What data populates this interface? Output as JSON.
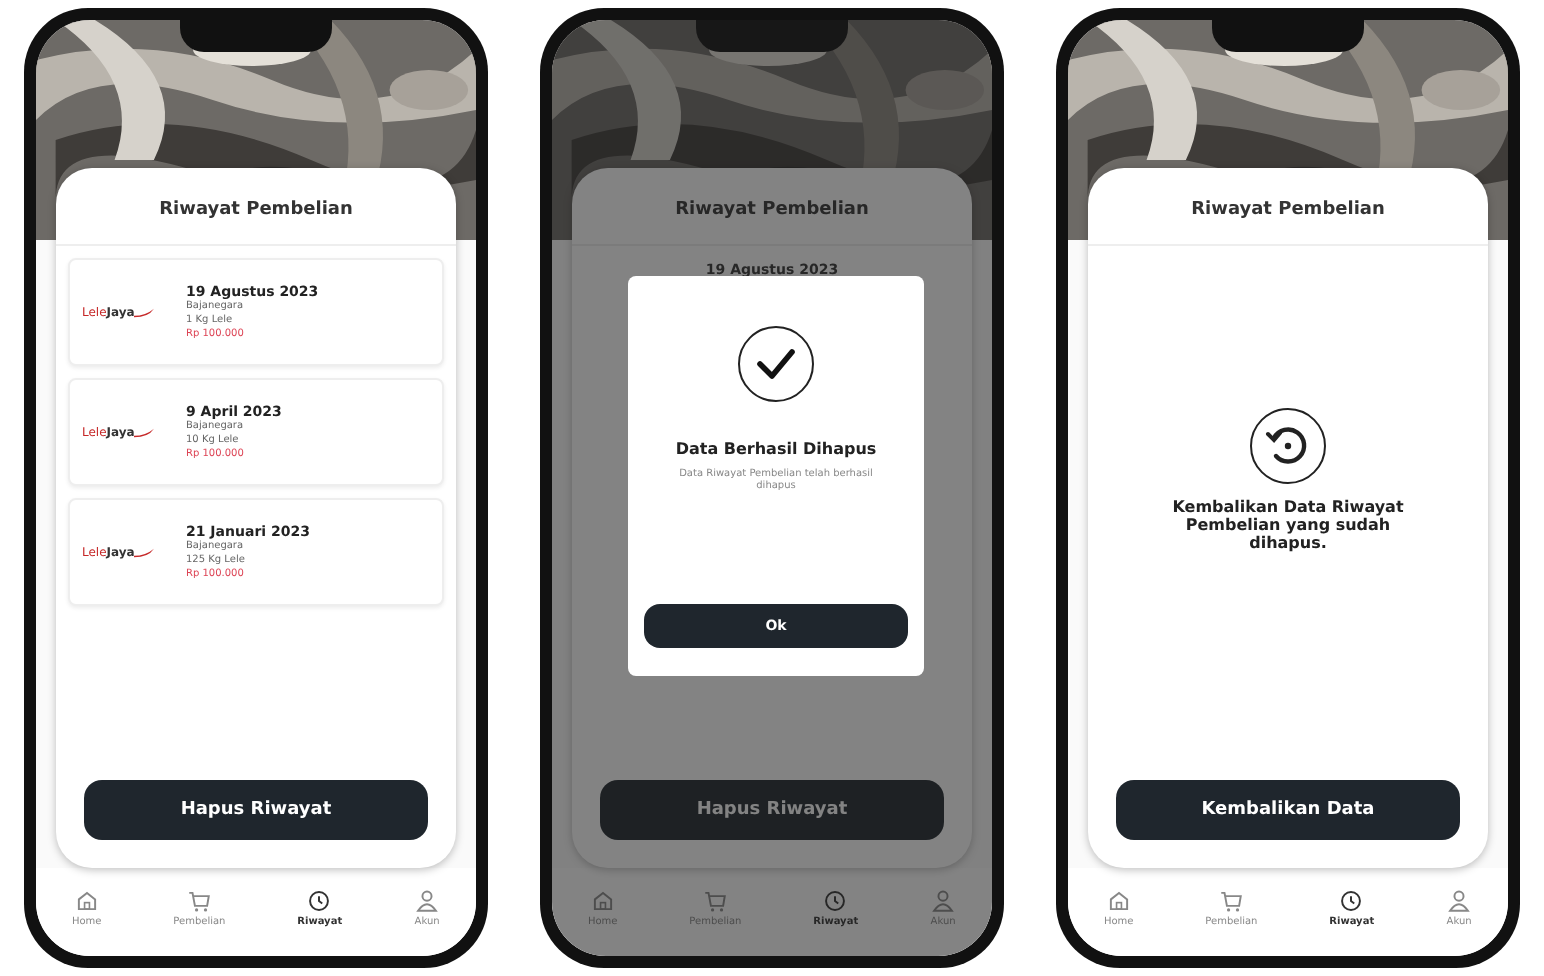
{
  "screens": [
    {
      "kind": "history",
      "title": "Riwayat Pembelian",
      "orders": [
        {
          "logo": [
            "Lele",
            "Jaya"
          ],
          "date": "19 Agustus 2023",
          "seller": "Bajanegara",
          "qty": "1 Kg Lele",
          "price": "Rp 100.000"
        },
        {
          "logo": [
            "Lele",
            "Jaya"
          ],
          "date": "9 April 2023",
          "seller": "Bajanegara",
          "qty": "10 Kg Lele",
          "price": "Rp 100.000"
        },
        {
          "logo": [
            "Lele",
            "Jaya"
          ],
          "date": "21 Januari 2023",
          "seller": "Bajanegara",
          "qty": "125 Kg Lele",
          "price": "Rp 100.000"
        }
      ],
      "button": "Hapus Riwayat",
      "nav": [
        {
          "kind": "home",
          "label": "Home",
          "selected": false
        },
        {
          "kind": "cart",
          "label": "Pembelian",
          "selected": false
        },
        {
          "kind": "history",
          "label": "Riwayat",
          "selected": true
        },
        {
          "kind": "user",
          "label": "Akun",
          "selected": false
        }
      ]
    },
    {
      "kind": "dialog",
      "title": "Riwayat Pembelian",
      "orders": [
        {
          "date": "19 Agustus 2023"
        }
      ],
      "dialog": {
        "title": "Data Berhasil Dihapus",
        "message": "Data Riwayat Pembelian telah berhasil dihapus",
        "button": "Ok"
      },
      "button": "Hapus Riwayat",
      "nav": [
        {
          "kind": "home",
          "label": "Home",
          "selected": false
        },
        {
          "kind": "cart",
          "label": "Pembelian",
          "selected": false
        },
        {
          "kind": "history",
          "label": "Riwayat",
          "selected": true
        },
        {
          "kind": "user",
          "label": "Akun",
          "selected": false
        }
      ]
    },
    {
      "kind": "restore",
      "title": "Riwayat Pembelian",
      "message": "Kembalikan Data Riwayat Pembelian yang sudah dihapus.",
      "button": "Kembalikan Data",
      "nav": [
        {
          "kind": "home",
          "label": "Home",
          "selected": false
        },
        {
          "kind": "cart",
          "label": "Pembelian",
          "selected": false
        },
        {
          "kind": "history",
          "label": "Riwayat",
          "selected": true
        },
        {
          "kind": "user",
          "label": "Akun",
          "selected": false
        }
      ]
    }
  ]
}
